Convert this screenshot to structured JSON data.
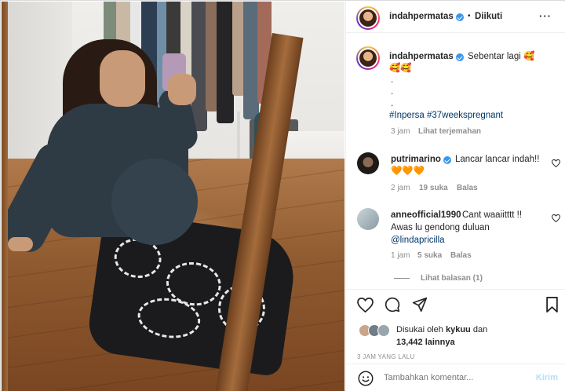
{
  "post": {
    "author": "indahpermatas",
    "follow_separator": "•",
    "follow_status": "Diikuti",
    "more_label": "···"
  },
  "caption": {
    "username": "indahpermatas",
    "text": "Sebentar lagi 🥰",
    "line2": "🥰🥰",
    "dots": [
      ".",
      ".",
      "."
    ],
    "hashtags": "#Inpersa #37weekspregnant",
    "age": "3 jam",
    "translate": "Lihat terjemahan"
  },
  "comments": [
    {
      "username": "putrimarino",
      "text": "Lancar lancar indah!!",
      "line2": "🧡🧡🧡",
      "age": "2 jam",
      "likes": "19 suka",
      "reply": "Balas"
    },
    {
      "username": "anneofficial1990",
      "text": "Cant waaiitttt !!",
      "line2": "Awas lu gendong duluan",
      "mention": "@lindapricilla",
      "age": "1 jam",
      "likes": "5 suka",
      "reply": "Balas",
      "view_replies": "Lihat balasan (1)"
    }
  ],
  "likes": {
    "prefix": "Disukai oleh",
    "user": "kykuu",
    "suffix": "dan",
    "count": "13,442 lainnya"
  },
  "timestamp": "3 JAM YANG LALU",
  "comment_box": {
    "placeholder": "Tambahkan komentar...",
    "post_label": "Kirim"
  },
  "colors": {
    "verified": "#3897f0",
    "hashtag": "#00376b",
    "muted": "#8e8e8e",
    "post_disabled": "#b2dffc"
  },
  "icons": [
    "heart-icon",
    "comment-icon",
    "share-icon",
    "bookmark-icon",
    "emoji-icon",
    "more-icon",
    "verified-icon"
  ]
}
